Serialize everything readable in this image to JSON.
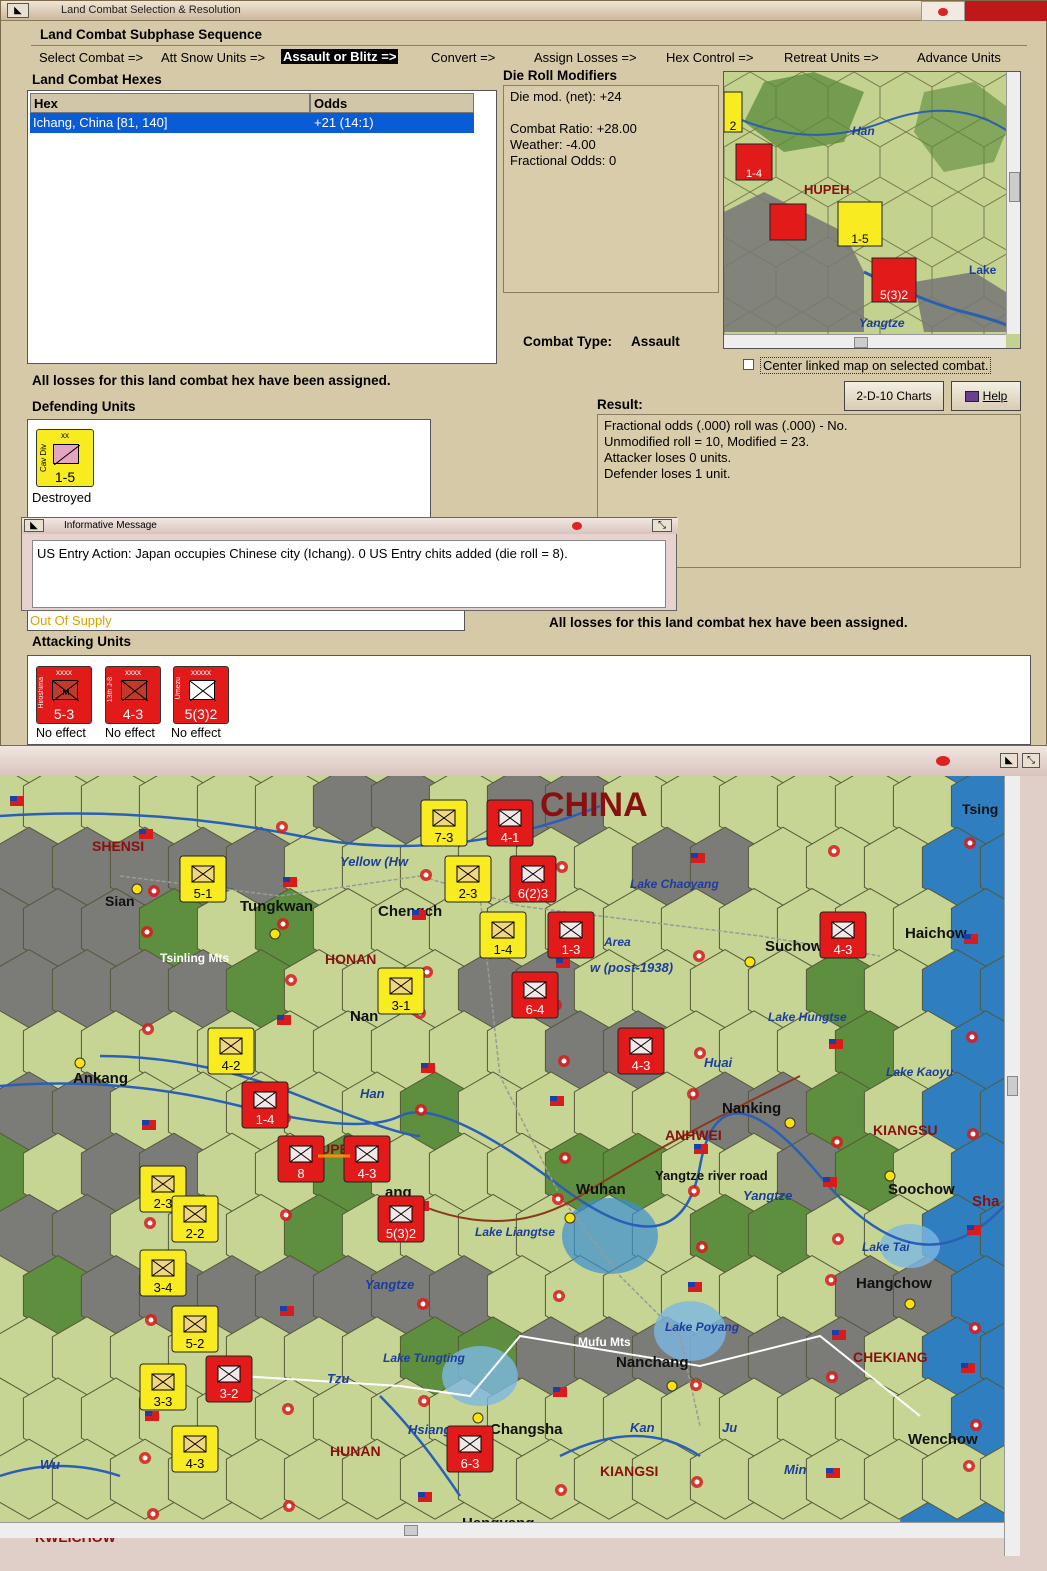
{
  "dialog": {
    "title": "Land Combat Selection & Resolution",
    "subphase_header": "Land Combat Subphase Sequence",
    "sequence": [
      {
        "label": "Select Combat =>",
        "active": false
      },
      {
        "label": "Att Snow Units =>",
        "active": false
      },
      {
        "label": "Assault or Blitz =>",
        "active": true
      },
      {
        "label": "Convert =>",
        "active": false
      },
      {
        "label": "Assign Losses =>",
        "active": false
      },
      {
        "label": "Hex Control =>",
        "active": false
      },
      {
        "label": "Retreat Units =>",
        "active": false
      },
      {
        "label": "Advance Units",
        "active": false
      }
    ],
    "hexes_header": "Land Combat Hexes",
    "hex_col": "Hex",
    "odds_col": "Odds",
    "hex_rows": [
      {
        "hex": "Ichang, China [81, 140]",
        "odds": "+21 (14:1)"
      }
    ],
    "modifiers_header": "Die Roll Modifiers",
    "modifiers": [
      "Die mod. (net): +24",
      "",
      "Combat Ratio: +28.00",
      "Weather: -4.00",
      "Fractional Odds: 0"
    ],
    "combat_type_label": "Combat Type:",
    "combat_type_value": "Assault",
    "center_linked": "Center linked map on selected combat.",
    "losses_assigned_top": "All losses for this land combat hex have been assigned.",
    "losses_assigned_bottom": "All losses for this land combat hex have been assigned.",
    "charts_button": "2-D-10 Charts",
    "help_button": "Help",
    "defending_header": "Defending Units",
    "defender": {
      "type": "Cav Div",
      "size": "xx",
      "value": "1-5",
      "status": "Destroyed"
    },
    "result_header": "Result:",
    "result_lines": [
      "Fractional odds (.000) roll was (.000)  - No.",
      "Unmodified roll = 10, Modified = 23.",
      "Attacker loses 0 units.",
      "Defender loses 1 unit."
    ],
    "out_of_supply": "Out Of Supply",
    "attacking_header": "Attacking Units",
    "attackers": [
      {
        "name": "Hiroshima",
        "size": "xxxx",
        "value": "5-3",
        "status": "No effect"
      },
      {
        "name": "13th J-8",
        "size": "xxxx",
        "value": "4-3",
        "status": "No effect"
      },
      {
        "name": "Umezu",
        "size": "xxxxx",
        "value": "5(3)2",
        "status": "No effect"
      }
    ]
  },
  "minimap": {
    "labels": [
      "Han",
      "HUPEH",
      "Lake",
      "Yangtze"
    ],
    "units": [
      "1-4",
      "1-5",
      "5(3)2",
      "2"
    ]
  },
  "message": {
    "title": "Informative Message",
    "text": "US Entry Action: Japan occupies Chinese city (Ichang).  0 US Entry chits added (die roll = 8)."
  },
  "colors": {
    "japan_red": "#e21a1a",
    "china_yellow": "#f8ec20",
    "highlight": "#0a5bd6",
    "beige": "#d6c9a8"
  },
  "map": {
    "labels": [
      {
        "text": "CHINA",
        "kind": "region-big"
      },
      {
        "text": "SHENSI",
        "kind": "province"
      },
      {
        "text": "Sian",
        "kind": "city"
      },
      {
        "text": "Tungkwan",
        "kind": "city"
      },
      {
        "text": "Chengch",
        "kind": "city"
      },
      {
        "text": "Yellow (Hw",
        "kind": "river"
      },
      {
        "text": "Lake Chaoyang",
        "kind": "lake"
      },
      {
        "text": "Suchow",
        "kind": "city"
      },
      {
        "text": "Haichow",
        "kind": "city"
      },
      {
        "text": "Tsinling Mts",
        "kind": "terrain"
      },
      {
        "text": "HONAN",
        "kind": "province"
      },
      {
        "text": "Area",
        "kind": "lake"
      },
      {
        "text": "w (post-1938)",
        "kind": "river"
      },
      {
        "text": "Nan",
        "kind": "city"
      },
      {
        "text": "Lake Hungtse",
        "kind": "lake"
      },
      {
        "text": "Ankang",
        "kind": "city"
      },
      {
        "text": "Huai",
        "kind": "river"
      },
      {
        "text": "Lake Kaoyu",
        "kind": "lake"
      },
      {
        "text": "Han",
        "kind": "river"
      },
      {
        "text": "Nanking",
        "kind": "city"
      },
      {
        "text": "ANHWEI",
        "kind": "province"
      },
      {
        "text": "KIANGSU",
        "kind": "province"
      },
      {
        "text": "HUPEH",
        "kind": "province"
      },
      {
        "text": "ang",
        "kind": "city"
      },
      {
        "text": "Wuhan",
        "kind": "city"
      },
      {
        "text": "Yangtze river road",
        "kind": "road"
      },
      {
        "text": "Yangtze",
        "kind": "river"
      },
      {
        "text": "Soochow",
        "kind": "city"
      },
      {
        "text": "Sha",
        "kind": "city"
      },
      {
        "text": "Lake Liangtse",
        "kind": "lake"
      },
      {
        "text": "Lake Tai",
        "kind": "lake"
      },
      {
        "text": "Yangtze",
        "kind": "river"
      },
      {
        "text": "Hangchow",
        "kind": "city"
      },
      {
        "text": "Mufu Mts",
        "kind": "terrain"
      },
      {
        "text": "Lake Poyang",
        "kind": "lake"
      },
      {
        "text": "Lake Tungting",
        "kind": "lake"
      },
      {
        "text": "Nanchang",
        "kind": "city"
      },
      {
        "text": "CHEKIANG",
        "kind": "province"
      },
      {
        "text": "Tzu",
        "kind": "river"
      },
      {
        "text": "Hsiang",
        "kind": "river"
      },
      {
        "text": "Changsha",
        "kind": "city"
      },
      {
        "text": "Kan",
        "kind": "river"
      },
      {
        "text": "Ju",
        "kind": "river"
      },
      {
        "text": "Wenchow",
        "kind": "city"
      },
      {
        "text": "HUNAN",
        "kind": "province"
      },
      {
        "text": "KIANGSI",
        "kind": "province"
      },
      {
        "text": "Min",
        "kind": "river"
      },
      {
        "text": "Wu",
        "kind": "river"
      },
      {
        "text": "KWEICHOW",
        "kind": "province"
      },
      {
        "text": "Hengyang",
        "kind": "city"
      },
      {
        "text": "Tsing",
        "kind": "city"
      }
    ],
    "units": [
      {
        "value": "7-3",
        "side": "china"
      },
      {
        "value": "4-1",
        "side": "japan"
      },
      {
        "value": "5-1",
        "side": "china"
      },
      {
        "value": "2-3",
        "side": "china"
      },
      {
        "value": "6(2)3",
        "side": "japan"
      },
      {
        "value": "1-4",
        "side": "china"
      },
      {
        "value": "1-3",
        "side": "japan"
      },
      {
        "value": "4-3",
        "side": "japan"
      },
      {
        "value": "3-1",
        "side": "china"
      },
      {
        "value": "6-4",
        "side": "japan"
      },
      {
        "value": "4-2",
        "side": "china"
      },
      {
        "value": "4-3",
        "side": "japan"
      },
      {
        "value": "1-4",
        "side": "japan"
      },
      {
        "value": "8",
        "side": "japan"
      },
      {
        "value": "4-3",
        "side": "japan"
      },
      {
        "value": "2-3",
        "side": "china"
      },
      {
        "value": "5(3)2",
        "side": "japan"
      },
      {
        "value": "2-2",
        "side": "china"
      },
      {
        "value": "3-4",
        "side": "china"
      },
      {
        "value": "5-2",
        "side": "china"
      },
      {
        "value": "3-2",
        "side": "japan"
      },
      {
        "value": "3-3",
        "side": "china"
      },
      {
        "value": "4-3",
        "side": "china"
      },
      {
        "value": "6-3",
        "side": "japan"
      }
    ]
  }
}
